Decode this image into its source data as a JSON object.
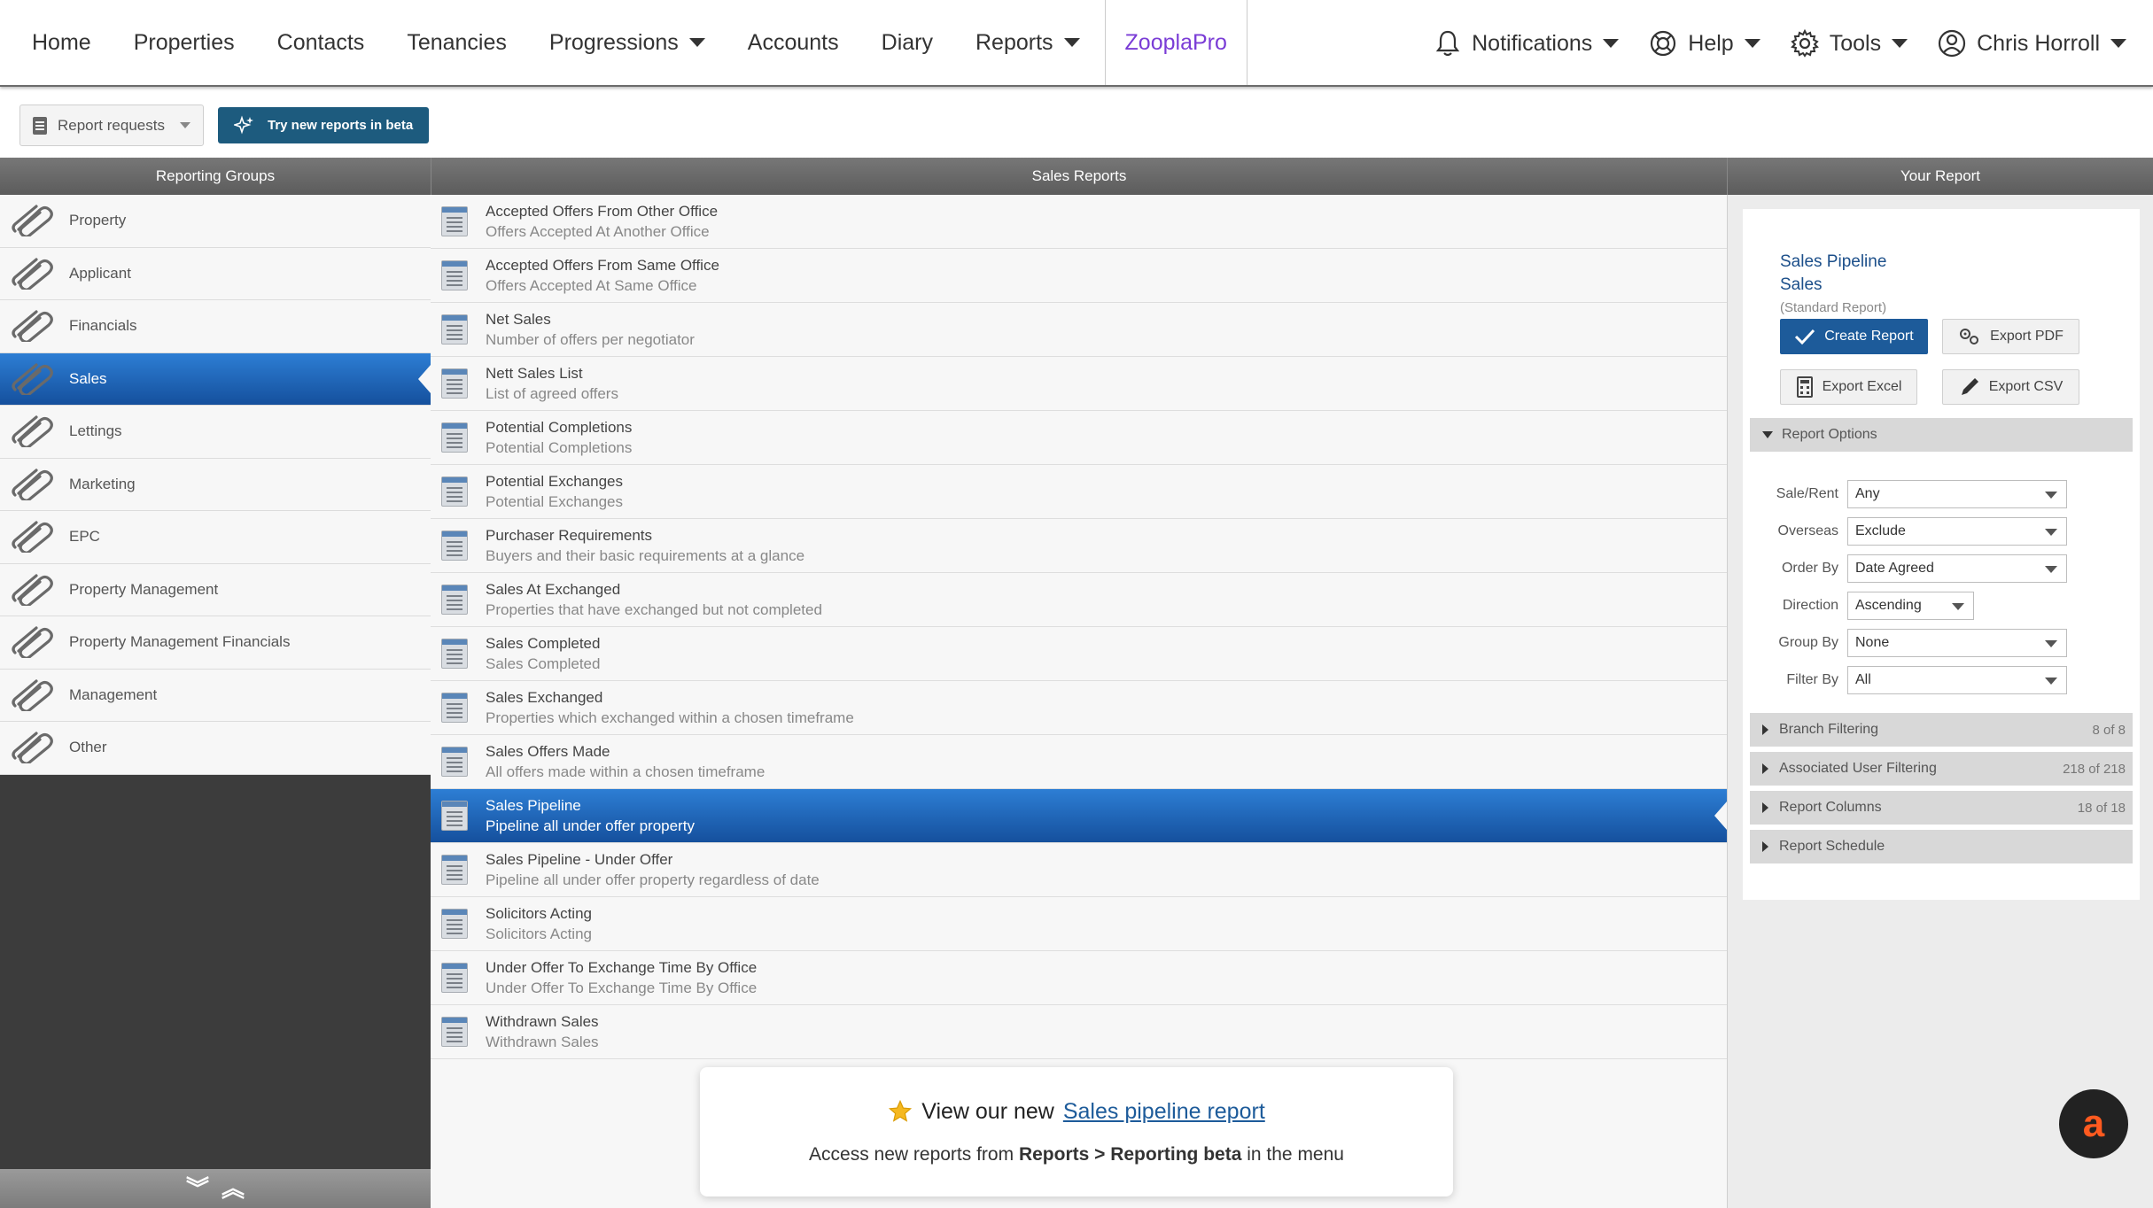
{
  "nav": {
    "home": "Home",
    "properties": "Properties",
    "contacts": "Contacts",
    "tenancies": "Tenancies",
    "progressions": "Progressions",
    "accounts": "Accounts",
    "diary": "Diary",
    "reports": "Reports",
    "zooplapro": "ZooplaPro",
    "notifications": "Notifications",
    "help": "Help",
    "tools": "Tools",
    "user": "Chris Horroll"
  },
  "toolbar": {
    "report_requests": "Report requests",
    "try_beta": "Try new reports in beta"
  },
  "headers": {
    "groups": "Reporting Groups",
    "reports": "Sales Reports",
    "your_report": "Your Report"
  },
  "groups": [
    {
      "label": "Property",
      "active": false
    },
    {
      "label": "Applicant",
      "active": false
    },
    {
      "label": "Financials",
      "active": false
    },
    {
      "label": "Sales",
      "active": true
    },
    {
      "label": "Lettings",
      "active": false
    },
    {
      "label": "Marketing",
      "active": false
    },
    {
      "label": "EPC",
      "active": false
    },
    {
      "label": "Property Management",
      "active": false
    },
    {
      "label": "Property Management Financials",
      "active": false
    },
    {
      "label": "Management",
      "active": false
    },
    {
      "label": "Other",
      "active": false
    }
  ],
  "reports": [
    {
      "title": "Accepted Offers From Other Office",
      "sub": "Offers Accepted At Another Office"
    },
    {
      "title": "Accepted Offers From Same Office",
      "sub": "Offers Accepted At Same Office"
    },
    {
      "title": "Net Sales",
      "sub": "Number of offers per negotiator"
    },
    {
      "title": "Nett Sales List",
      "sub": "List of agreed offers"
    },
    {
      "title": "Potential Completions",
      "sub": "Potential Completions"
    },
    {
      "title": "Potential Exchanges",
      "sub": "Potential Exchanges"
    },
    {
      "title": "Purchaser Requirements",
      "sub": "Buyers and their basic requirements at a glance"
    },
    {
      "title": "Sales At Exchanged",
      "sub": "Properties that have exchanged but not completed"
    },
    {
      "title": "Sales Completed",
      "sub": "Sales Completed"
    },
    {
      "title": "Sales Exchanged",
      "sub": "Properties which exchanged within a chosen timeframe"
    },
    {
      "title": "Sales Offers Made",
      "sub": "All offers made within a chosen timeframe"
    },
    {
      "title": "Sales Pipeline",
      "sub": "Pipeline all under offer property",
      "active": true
    },
    {
      "title": "Sales Pipeline - Under Offer",
      "sub": "Pipeline all under offer property regardless of date"
    },
    {
      "title": "Solicitors Acting",
      "sub": "Solicitors Acting"
    },
    {
      "title": "Under Offer To Exchange Time By Office",
      "sub": "Under Offer To Exchange Time By Office"
    },
    {
      "title": "Withdrawn Sales",
      "sub": "Withdrawn Sales"
    }
  ],
  "your_report": {
    "name": "Sales Pipeline",
    "group": "Sales",
    "kind": "(Standard Report)",
    "create": "Create Report",
    "export_pdf": "Export PDF",
    "export_excel": "Export Excel",
    "export_csv": "Export CSV",
    "options_title": "Report Options",
    "options": [
      {
        "label": "Sale/Rent",
        "value": "Any"
      },
      {
        "label": "Overseas",
        "value": "Exclude"
      },
      {
        "label": "Order By",
        "value": "Date Agreed"
      },
      {
        "label": "Direction",
        "value": "Ascending"
      },
      {
        "label": "Group By",
        "value": "None"
      },
      {
        "label": "Filter By",
        "value": "All"
      }
    ],
    "sections": [
      {
        "label": "Branch Filtering",
        "count": "8 of 8"
      },
      {
        "label": "Associated User Filtering",
        "count": "218 of 218"
      },
      {
        "label": "Report Columns",
        "count": "18 of 18"
      },
      {
        "label": "Report Schedule",
        "count": ""
      }
    ]
  },
  "promo": {
    "prefix": "View our new",
    "link": "Sales pipeline report",
    "line2_a": "Access new reports from",
    "line2_b": "Reports > Reporting beta",
    "line2_c": "in the menu"
  },
  "colors": {
    "accent": "#1d5b9a",
    "active_gradient_top": "#2d7ed4",
    "active_gradient_bottom": "#15509d",
    "zooplapro": "#7a3cd6"
  }
}
